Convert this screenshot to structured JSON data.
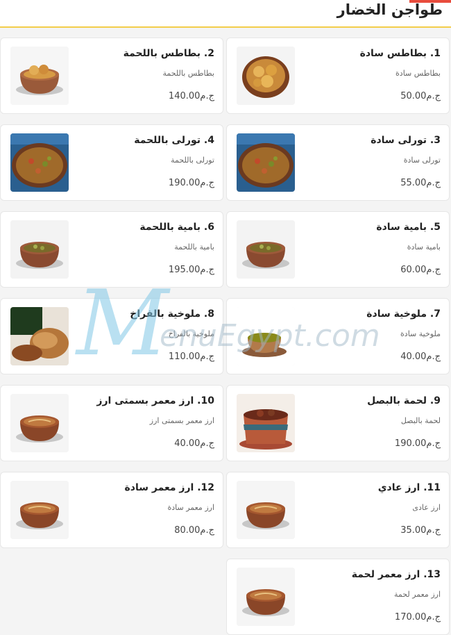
{
  "section": {
    "title": "طواجن الخضار"
  },
  "currency": "ج.م",
  "watermark": "MenuEgypt.com",
  "items": [
    {
      "name": "1. بطاطس سادة",
      "desc": "بطاطس سادة",
      "price": "50.00",
      "image": "potato-dish"
    },
    {
      "name": "2. بطاطس باللحمة",
      "desc": "بطاطس باللحمة",
      "price": "140.00",
      "image": "potato-meat-tagine"
    },
    {
      "name": "3. تورلى سادة",
      "desc": "تورلى سادة",
      "price": "55.00",
      "image": "turli-tray"
    },
    {
      "name": "4. تورلى باللحمة",
      "desc": "تورلى باللحمة",
      "price": "190.00",
      "image": "turli-tray"
    },
    {
      "name": "5. بامية سادة",
      "desc": "بامية سادة",
      "price": "60.00",
      "image": "okra-tagine"
    },
    {
      "name": "6. بامية باللحمة",
      "desc": "بامية باللحمة",
      "price": "195.00",
      "image": "okra-tagine"
    },
    {
      "name": "7. ملوخية سادة",
      "desc": "ملوخية سادة",
      "price": "40.00",
      "image": "molokhia-bowl"
    },
    {
      "name": "8. ملوخية بالفراخ",
      "desc": "ملوخية بالفراخ",
      "price": "110.00",
      "image": "molokhia-chicken"
    },
    {
      "name": "9. لحمة بالبصل",
      "desc": "لحمة بالبصل",
      "price": "190.00",
      "image": "meat-onion-tagine"
    },
    {
      "name": "10. ارز معمر بسمتى ارز",
      "desc": "ارز معمر بسمتى ارز",
      "price": "40.00",
      "image": "rice-tagine"
    },
    {
      "name": "11. ارز عادي",
      "desc": "ارز عادى",
      "price": "35.00",
      "image": "rice-tagine"
    },
    {
      "name": "12. ارز معمر سادة",
      "desc": "ارز معمر سادة",
      "price": "80.00",
      "image": "rice-tagine"
    },
    {
      "name": "13. ارز معمر لحمة",
      "desc": "ارز معمر لحمة",
      "price": "170.00",
      "image": "rice-tagine"
    }
  ]
}
